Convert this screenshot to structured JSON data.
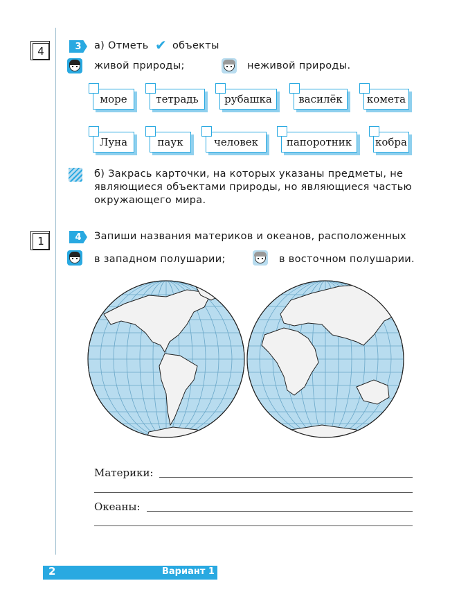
{
  "score_boxes": [
    "4",
    "1"
  ],
  "task3": {
    "number": "3",
    "line_a": "а) Отметь",
    "line_a_end": "объекты",
    "living": "живой природы;",
    "nonliving": "неживой природы.",
    "cards_row1": [
      "море",
      "тетрадь",
      "рубашка",
      "василёк",
      "комета"
    ],
    "cards_row2": [
      "Луна",
      "паук",
      "человек",
      "папоротник",
      "кобра"
    ],
    "part_b": [
      "б) Закрась карточки, на которых указаны предметы, не",
      "являющиеся объектами природы, но являющиеся частью",
      "окружающего мира."
    ]
  },
  "task4": {
    "number": "4",
    "prompt": "Запиши названия материков и океанов, расположенных",
    "western": "в западном полушарии;",
    "eastern": "в восточном полушарии.",
    "continents_label": "Материки:",
    "oceans_label": "Океаны:"
  },
  "footer": {
    "page_number": "2",
    "variant": "Вариант 1"
  },
  "colors": {
    "accent": "#29a9e1",
    "ocean": "#b8dcef",
    "land": "#f2f2f2"
  },
  "icons": [
    "check-icon",
    "boy-face-icon",
    "girl-face-icon",
    "pencil-icon"
  ]
}
